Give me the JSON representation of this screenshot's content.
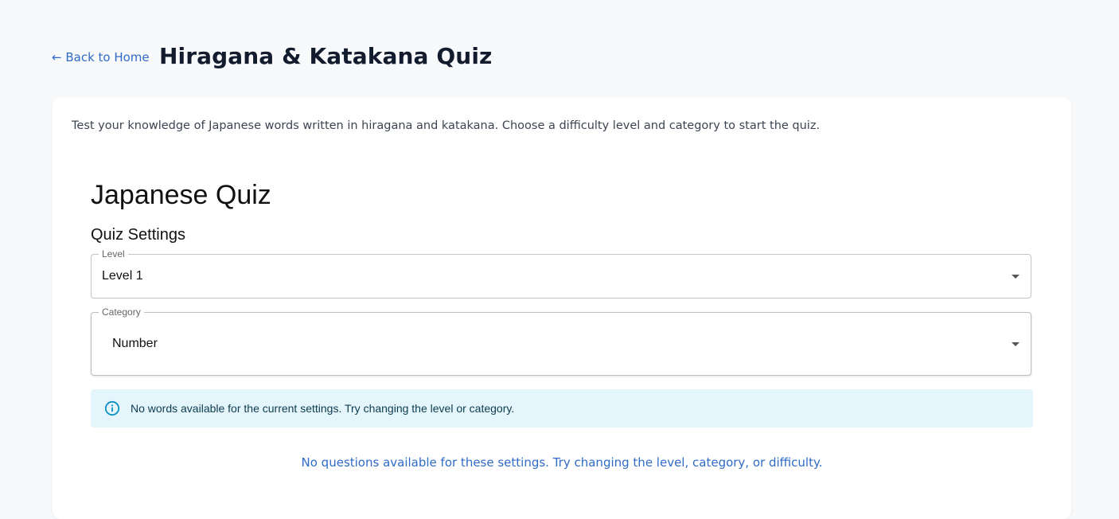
{
  "header": {
    "back_link": "← Back to Home",
    "title": "Hiragana & Katakana Quiz"
  },
  "card": {
    "intro": "Test your knowledge of Japanese words written in hiragana and katakana. Choose a difficulty level and category to start the quiz.",
    "quiz_title": "Japanese Quiz",
    "settings_title": "Quiz Settings",
    "level": {
      "label": "Level",
      "value": "Level 1"
    },
    "category": {
      "label": "Category",
      "value": "Number"
    },
    "alert": {
      "icon": "info-icon",
      "text": "No words available for the current settings. Try changing the level or category."
    },
    "empty_note": "No questions available for these settings. Try changing the level, category, or difficulty."
  },
  "colors": {
    "page_bg": "#f8f9fb",
    "link": "#2f6bc7",
    "title": "#131c2e",
    "alert_bg": "#e4f5fb",
    "alert_icon": "#0a8fc4"
  }
}
